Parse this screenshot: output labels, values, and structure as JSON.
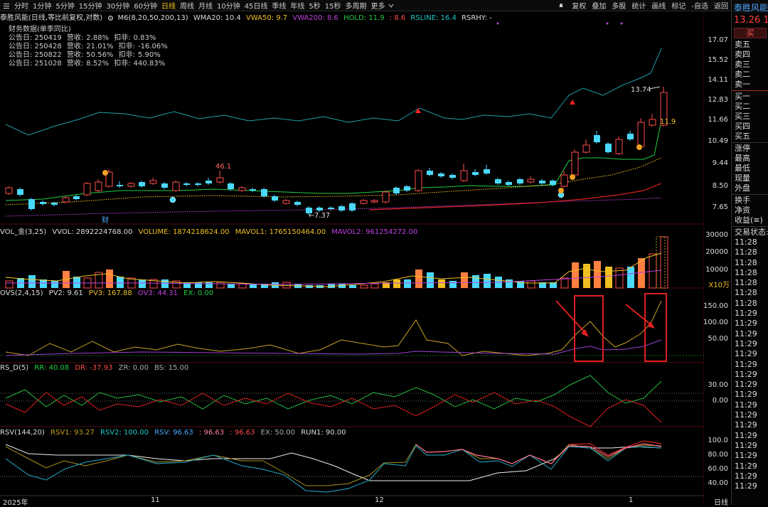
{
  "toolbar": {
    "periods": [
      "分时",
      "1分钟",
      "5分钟",
      "15分钟",
      "30分钟",
      "60分钟",
      "日线",
      "周线",
      "月线",
      "10分钟",
      "45日线",
      "季线",
      "年线",
      "5秒",
      "15秒",
      "多周期",
      "更多"
    ],
    "active": "日线",
    "right_buttons": [
      "复权",
      "叠加",
      "多股",
      "统计",
      "画线",
      "标记",
      "-自选",
      "返回"
    ]
  },
  "chart_title": {
    "name": "泰胜风能(日线,等比前复权,对数)",
    "indicator": "M6(8,20,50,200,13)",
    "wma20": "WMA20: 10.4",
    "vwa50": "VWA50: 9.7",
    "vwa200": "VWA200: 8.6",
    "hold": "HOLD: 11.9",
    "hold2": ": 8.6",
    "rsline": "RSLINE: 16.4",
    "rsrhy": "RSRHY: -"
  },
  "financials": {
    "title": "财务数据(单季同比)",
    "rows": [
      {
        "date": "公告日: 250419",
        "rev_label": "营收:",
        "rev": "2.88%",
        "net_label": "扣非:",
        "net": "0.83%"
      },
      {
        "date": "公告日: 250428",
        "rev_label": "营收:",
        "rev": "21.01%",
        "net_label": "扣非:",
        "net": "-16.06%"
      },
      {
        "date": "公告日: 250822",
        "rev_label": "营收:",
        "rev": "50.56%",
        "net_label": "扣非:",
        "net": "5.90%"
      },
      {
        "date": "公告日: 251028",
        "rev_label": "营收:",
        "rev": "8.52%",
        "net_label": "扣非:",
        "net": "440.83%"
      }
    ]
  },
  "annotations": {
    "high": "46.1",
    "low": "7.37",
    "last_high": "13.74",
    "hold_tag": "11.9",
    "fin_marker": "财"
  },
  "price_axis": [
    "17.07",
    "15.52",
    "14.11",
    "12.83",
    "11.66",
    "10.49",
    "9.44",
    "8.50",
    "7.65"
  ],
  "volume_panel": {
    "name": "VOL_金(3,25)",
    "vvol": "VVOL: 2892224768.00",
    "volume": "VOLUME: 1874218624.00",
    "mavol1": "MAVOL1: 1765150464.00",
    "mavol2": "MAVOL2: 961254272.00",
    "axis": [
      "30000",
      "20000",
      "10000"
    ],
    "unit": "X10万"
  },
  "ovs_panel": {
    "name": "OVS(2,4,15)",
    "pv2": "PV2: 9.61",
    "pv3": "PV3: 167.88",
    "ov3": "OV3: 44.31",
    "ex": "EX: 0.00",
    "axis": [
      "150.00",
      "100.00",
      "50.00"
    ]
  },
  "rsd_panel": {
    "name": "RS_D(5)",
    "rr": "RR: 40.08",
    "dr": "DR: -37.93",
    "zr": "ZR: 0.00",
    "bs": "BS: 15.00",
    "axis": [
      "30.00",
      "0.00"
    ]
  },
  "rsv_panel": {
    "name": "RSV(144,20)",
    "rsv1": "RSV1: 93.27",
    "rsv2": "RSV2: 100.00",
    "rsv": "RSV: 96.63",
    "v1": ": 96.63",
    "v2": ": 96.63",
    "ex": "EX: 50.00",
    "run1": "RUN1: 90.00",
    "axis": [
      "100.0",
      "80.00",
      "60.00",
      "40.00"
    ]
  },
  "date_axis": [
    "2025年",
    "11",
    "12",
    "1"
  ],
  "bottom_tab": "日线",
  "right_panel": {
    "name": "泰胜风能",
    "price": "13.26",
    "price2": "1",
    "buy": "买",
    "sell_levels": [
      "卖五",
      "卖四",
      "卖三",
      "卖二",
      "卖一"
    ],
    "buy_levels": [
      "买一",
      "买二",
      "买三",
      "买四",
      "买五"
    ],
    "stats": [
      "涨停",
      "最高",
      "最低",
      "现量",
      "外盘"
    ],
    "stats2": [
      "换手",
      "净资",
      "收益(≡)"
    ],
    "trade_status": "交易状态:",
    "times": [
      "11:28",
      "11:28",
      "11:28",
      "11:28",
      "11:28",
      "11:28",
      "11:28",
      "11:29",
      "11:29",
      "11:29",
      "11:29",
      "11:29",
      "11:29",
      "11:29",
      "11:29",
      "11:29",
      "11:29",
      "11:29",
      "11:29",
      "11:29",
      "11:29",
      "11:29",
      "11:29",
      "11:29",
      "11:29"
    ]
  },
  "colors": {
    "up": "#ff4d4d",
    "down": "#4ad9ff",
    "gold": "#f0c020",
    "purple": "#c040e0",
    "green": "#22cc44",
    "teal": "#1ec8c8",
    "highlight": "#e02020"
  }
}
